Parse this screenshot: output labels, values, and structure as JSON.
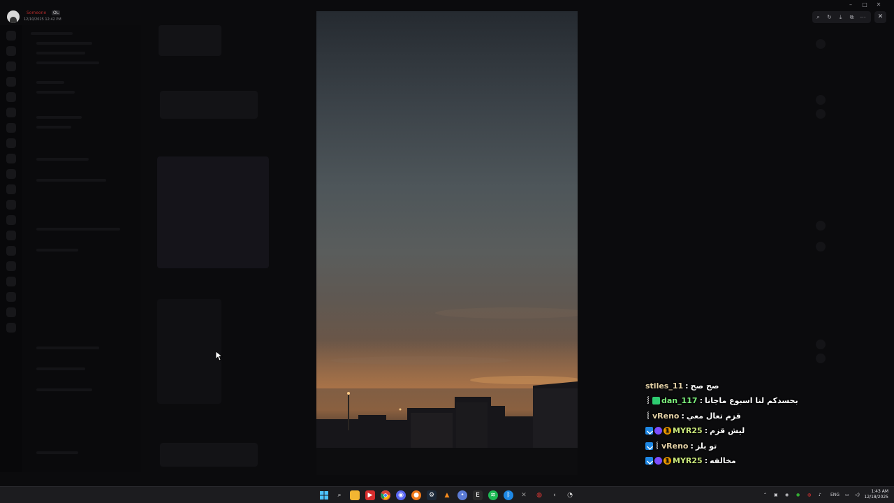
{
  "app": {
    "user_name": "Someone",
    "user_tag": "OL",
    "user_timestamp": "12/10/2025 12:42 PM"
  },
  "window": {
    "controls": [
      "minimize",
      "maximize",
      "close"
    ]
  },
  "viewer_toolbar": {
    "buttons": [
      "zoom-icon",
      "rotate-icon",
      "download-icon",
      "open-external-icon",
      "more-icon"
    ],
    "close": "close-icon"
  },
  "photo": {
    "subject": "evening sky over rooftops"
  },
  "chat": {
    "messages": [
      {
        "badges": [],
        "user": "stiles_11",
        "color": "#e6d3a8",
        "separator": ":",
        "text": "صح صح"
      },
      {
        "badges": [
          "mod",
          "green"
        ],
        "user": "dan_117",
        "color": "#7cf07c",
        "separator": ":",
        "text": "بحسدكم لنا اسبوع ماجانا"
      },
      {
        "badges": [
          "mod"
        ],
        "user": "vReno",
        "color": "#e6d3a8",
        "separator": ":",
        "text": "قزم تعال معي"
      },
      {
        "badges": [
          "prime",
          "verified",
          "one"
        ],
        "user": "MYR25",
        "color": "#c9e77a",
        "separator": ":",
        "text": "ليش قزم"
      },
      {
        "badges": [
          "prime",
          "mod"
        ],
        "user": "vReno",
        "color": "#e6d3a8",
        "separator": ":",
        "text": "تو بلز"
      },
      {
        "badges": [
          "prime",
          "verified",
          "one"
        ],
        "user": "MYR25",
        "color": "#c9e77a",
        "separator": ":",
        "text": "مخالفه"
      }
    ]
  },
  "taskbar": {
    "apps": [
      "windows-start-icon",
      "search-icon",
      "file-explorer-icon",
      "media-app-icon",
      "chrome-icon",
      "discord-icon",
      "browser-icon",
      "steam-icon",
      "vlc-icon",
      "app-icon",
      "epic-icon",
      "spotify-icon",
      "bluetooth-icon",
      "editor-icon",
      "app-red-icon",
      "back-icon",
      "clock-app-icon"
    ],
    "language": "ENG",
    "time": "1:43 AM",
    "date": "12/18/2025"
  }
}
